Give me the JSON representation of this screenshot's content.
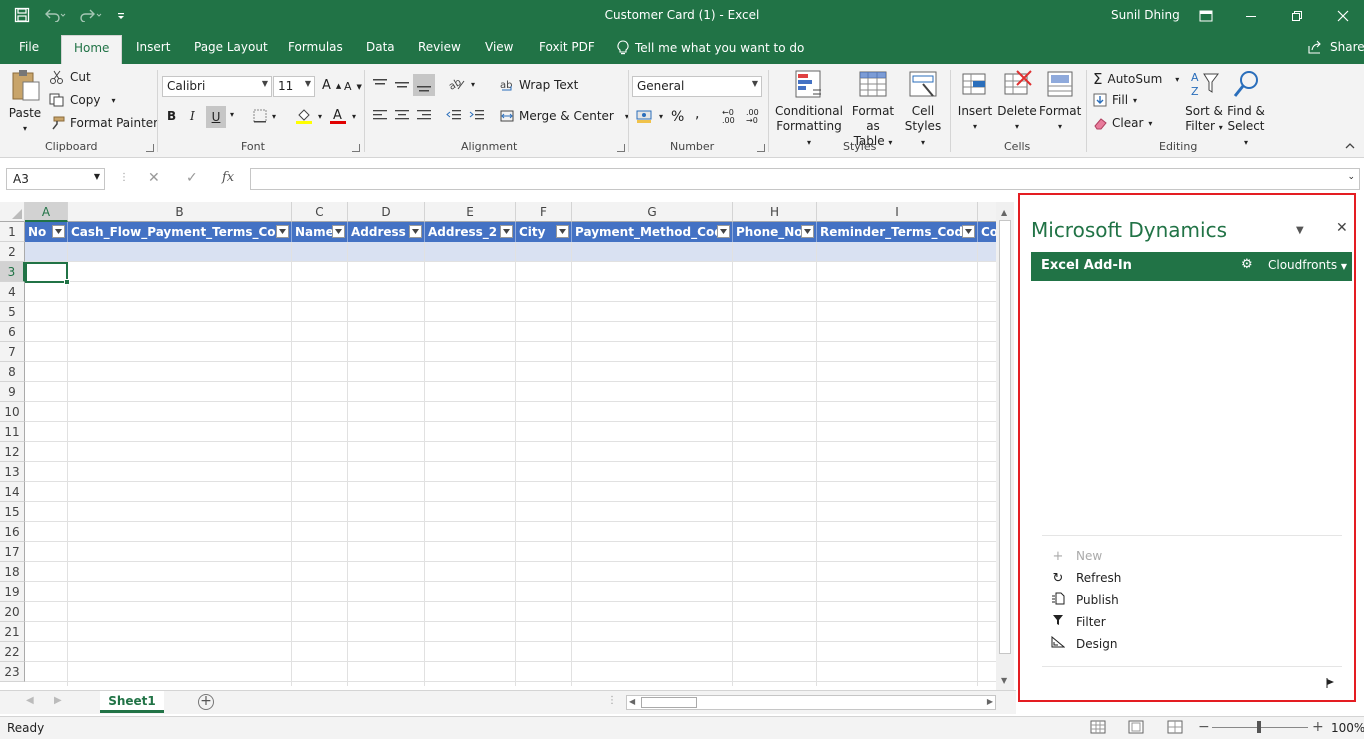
{
  "window": {
    "title": "Customer Card (1)  -  Excel",
    "user": "Sunil Dhing"
  },
  "tabs": [
    "File",
    "Home",
    "Insert",
    "Page Layout",
    "Formulas",
    "Data",
    "Review",
    "View",
    "Foxit PDF"
  ],
  "tell_me": "Tell me what you want to do",
  "share": "Share",
  "ribbon": {
    "clipboard": {
      "paste": "Paste",
      "cut": "Cut",
      "copy": "Copy",
      "format_painter": "Format Painter",
      "label": "Clipboard"
    },
    "font": {
      "name": "Calibri",
      "size": "11",
      "bold": "B",
      "italic": "I",
      "underline": "U",
      "label": "Font"
    },
    "alignment": {
      "wrap_text": "Wrap Text",
      "merge_center": "Merge & Center",
      "label": "Alignment"
    },
    "number": {
      "format": "General",
      "label": "Number"
    },
    "styles": {
      "conditional": "Conditional",
      "conditional2": "Formatting",
      "format_as": "Format as",
      "format_as2": "Table",
      "cell": "Cell",
      "cell2": "Styles",
      "label": "Styles"
    },
    "cells": {
      "insert": "Insert",
      "delete": "Delete",
      "format": "Format",
      "label": "Cells"
    },
    "editing": {
      "autosum": "AutoSum",
      "fill": "Fill",
      "clear": "Clear",
      "sort": "Sort &",
      "sort2": "Filter",
      "find": "Find &",
      "find2": "Select",
      "label": "Editing"
    }
  },
  "formula_bar": {
    "name_box": "A3",
    "fx": "fx",
    "value": ""
  },
  "columns": [
    "A",
    "B",
    "C",
    "D",
    "E",
    "F",
    "G",
    "H",
    "I"
  ],
  "header_cells": [
    "No",
    "Cash_Flow_Payment_Terms_Cod",
    "Name",
    "Address",
    "Address_2",
    "City",
    "Payment_Method_Cod",
    "Phone_No",
    "Reminder_Terms_Code",
    "Co"
  ],
  "rows": [
    "1",
    "2",
    "3",
    "4",
    "5",
    "6",
    "7",
    "8",
    "9",
    "10",
    "11",
    "12",
    "13",
    "14",
    "15",
    "16",
    "17",
    "18",
    "19",
    "20",
    "21",
    "22",
    "23"
  ],
  "sheet": {
    "name": "Sheet1"
  },
  "status": {
    "ready": "Ready",
    "zoom": "100%"
  },
  "pane": {
    "title": "Microsoft Dynamics",
    "bar_title": "Excel Add-In",
    "connection": "Cloudfronts",
    "actions": {
      "new": "New",
      "refresh": "Refresh",
      "publish": "Publish",
      "filter": "Filter",
      "design": "Design"
    }
  },
  "colors": {
    "excel_green": "#217346",
    "table_header": "#4472c4",
    "band": "#d9e1f2",
    "highlight": "#e41d22"
  }
}
